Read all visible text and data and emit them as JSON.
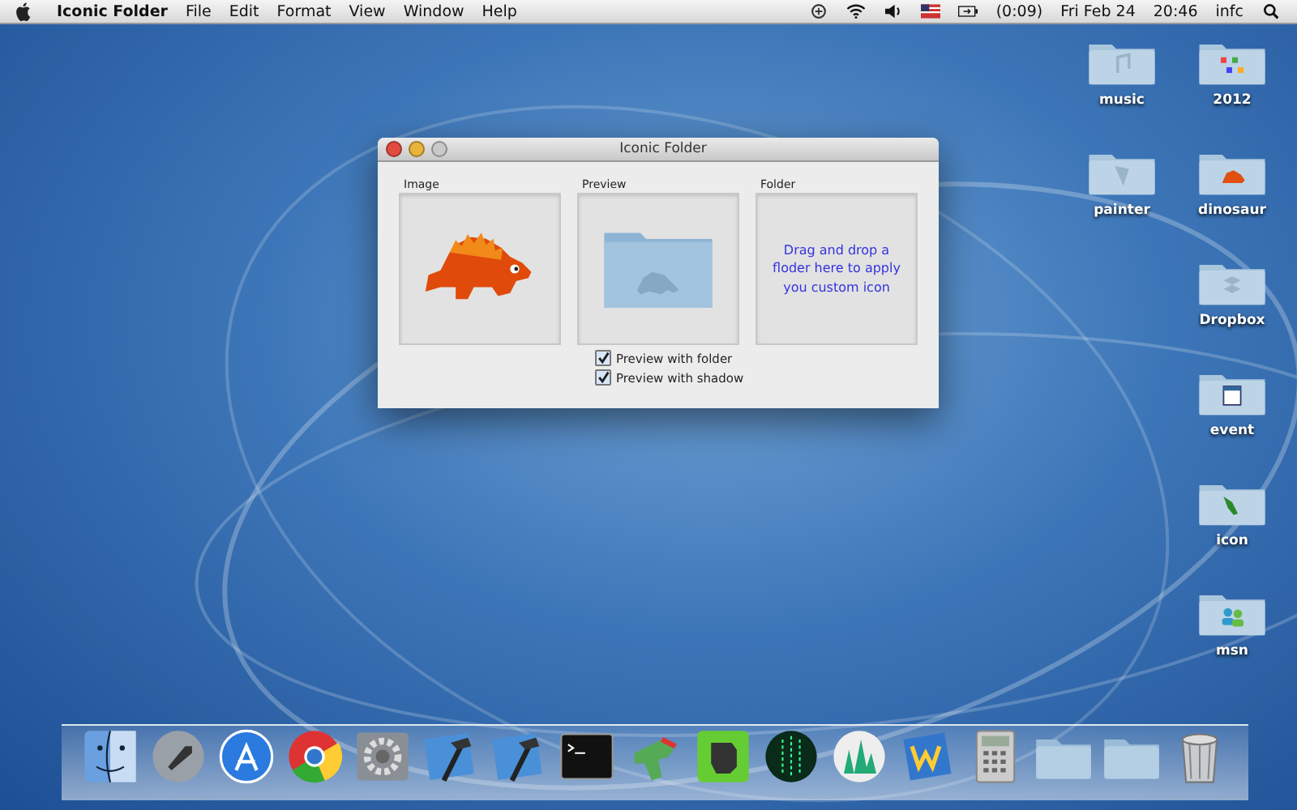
{
  "menu_bar": {
    "app_name": "Iconic Folder",
    "menus": [
      "File",
      "Edit",
      "Format",
      "View",
      "Window",
      "Help"
    ],
    "battery_time": "(0:09)",
    "date": "Fri Feb 24",
    "time": "20:46",
    "user": "infc"
  },
  "window": {
    "title": "Iconic Folder",
    "panels": [
      {
        "kind": "image",
        "label": "Image"
      },
      {
        "kind": "preview",
        "label": "Preview"
      },
      {
        "kind": "drop",
        "label": "Folder",
        "message": "Drag and drop a floder here to apply you custom icon"
      }
    ],
    "options": [
      {
        "label": "Preview with folder",
        "checked": true
      },
      {
        "label": "Preview with shadow",
        "checked": true
      }
    ]
  },
  "desktop_columns": [
    [
      {
        "kind": "music",
        "label": "music"
      },
      {
        "kind": "brush",
        "label": "painter"
      }
    ],
    [
      {
        "kind": "colors",
        "label": "2012"
      },
      {
        "kind": "dino",
        "label": "dinosaur"
      },
      {
        "kind": "box",
        "label": "Dropbox"
      },
      {
        "kind": "calendar",
        "label": "event"
      },
      {
        "kind": "dino-green",
        "label": "icon"
      },
      {
        "kind": "people",
        "label": "msn"
      }
    ]
  ]
}
